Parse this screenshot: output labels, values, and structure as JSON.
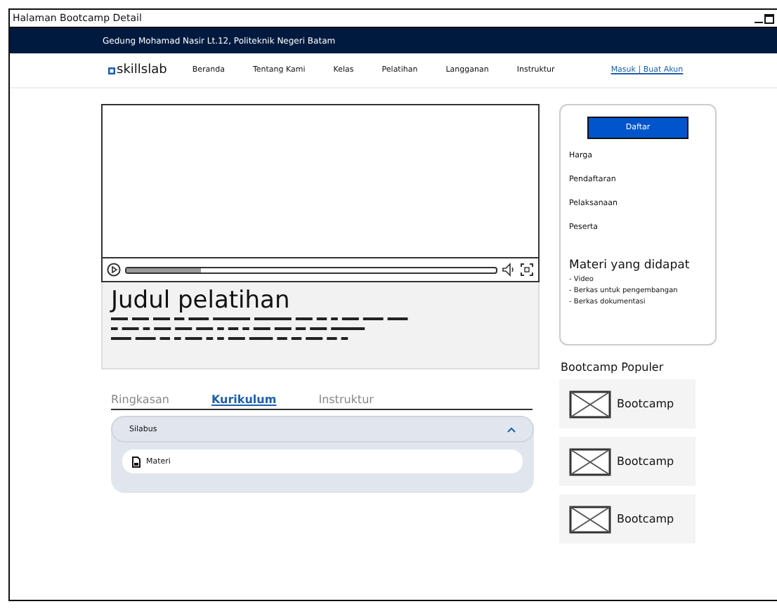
{
  "window": {
    "title": "Halaman Bootcamp Detail"
  },
  "topbar": {
    "address": "Gedung Mohamad Nasir Lt.12, Politeknik Negeri Batam"
  },
  "navbar": {
    "logo": "skillslab",
    "items": [
      "Beranda",
      "Tentang Kami",
      "Kelas",
      "Pelatihan",
      "Langganan",
      "Instruktur"
    ],
    "auth_link": "Masuk | Buat Akun"
  },
  "video": {
    "level": 0.2
  },
  "course": {
    "title": "Judul pelatihan"
  },
  "tabs": [
    {
      "label": "Ringkasan",
      "selected": false
    },
    {
      "label": "Kurikulum",
      "selected": true
    },
    {
      "label": "Instruktur",
      "selected": false
    }
  ],
  "syllabus": {
    "title": "Silabus",
    "expanded": true,
    "items": [
      "Materi"
    ]
  },
  "sidebar": {
    "button": "Daftar",
    "info": [
      "Harga",
      "Pendaftaran",
      "Pelaksanaan",
      "Peserta"
    ],
    "materials_title": "Materi yang didapat",
    "materials": [
      "- Video",
      "- Berkas untuk pengembangan",
      "- Berkas dokumentasi"
    ]
  },
  "popular": {
    "title": "Bootcamp Populer",
    "items": [
      "Bootcamp",
      "Bootcamp",
      "Bootcamp"
    ]
  }
}
